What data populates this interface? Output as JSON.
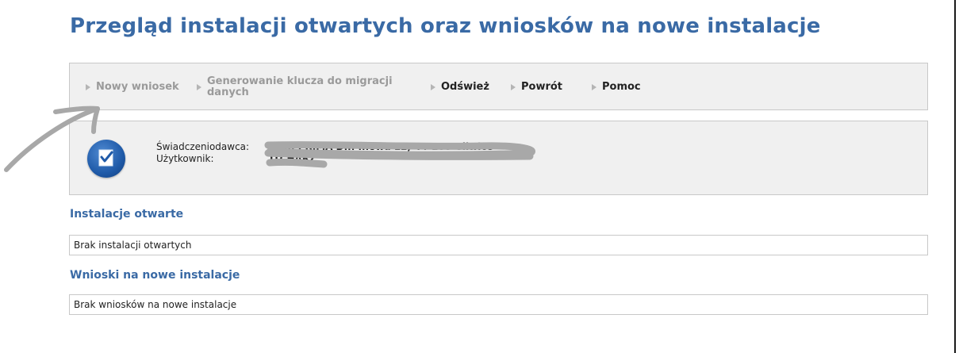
{
  "page": {
    "title": "Przegląd instalacji otwartych oraz wniosków na nowe instalacje"
  },
  "toolbar": {
    "items": [
      {
        "label": "Nowy wniosek",
        "enabled": false
      },
      {
        "label": "Generowanie klucza do migracji danych",
        "enabled": false
      },
      {
        "label": "Odśwież",
        "enabled": true
      },
      {
        "label": "Powrót",
        "enabled": true
      },
      {
        "label": "Pomoc",
        "enabled": true
      }
    ]
  },
  "info": {
    "provider_label": "Świadczeniodawca:",
    "user_label": "Użytkownik:",
    "provider_value": "Ap... PRIMA D... ...owa 12, 44-100 Gliwice",
    "user_value": "ITCHARZ",
    "icon": "checkbox-document-icon"
  },
  "sections": {
    "open_installations": {
      "title": "Instalacje otwarte",
      "message": "Brak instalacji otwartych"
    },
    "new_requests": {
      "title": "Wnioski na nowe instalacje",
      "message": "Brak wniosków na nowe instalacje"
    }
  },
  "colors": {
    "accent": "#3a6aa5",
    "panel_bg": "#f0f0f0",
    "border": "#c8c8c8",
    "disabled_text": "#9a9a9a",
    "scribble": "#a8a8a8"
  }
}
